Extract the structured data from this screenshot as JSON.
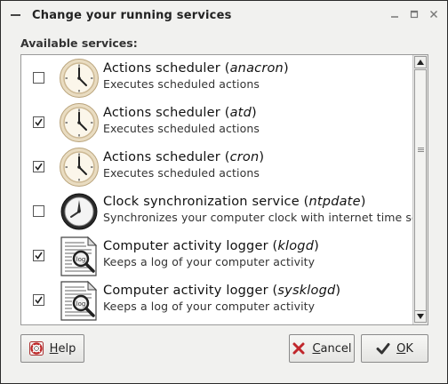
{
  "window": {
    "title": "Change your running services"
  },
  "main": {
    "section_label": "Available services:",
    "services": [
      {
        "name": "Actions scheduler (",
        "id": "anacron",
        "tail": ")",
        "description": "Executes scheduled actions",
        "checked": false,
        "icon": "clock-icon"
      },
      {
        "name": "Actions scheduler (",
        "id": "atd",
        "tail": ")",
        "description": "Executes scheduled actions",
        "checked": true,
        "icon": "clock-icon"
      },
      {
        "name": "Actions scheduler (",
        "id": "cron",
        "tail": ")",
        "description": "Executes scheduled actions",
        "checked": true,
        "icon": "clock-icon"
      },
      {
        "name": "Clock synchronization service (",
        "id": "ntpdate",
        "tail": ")",
        "description": "Synchronizes your computer clock with internet time servers",
        "checked": false,
        "icon": "sync-clock-icon"
      },
      {
        "name": "Computer activity logger (",
        "id": "klogd",
        "tail": ")",
        "description": "Keeps a log of your computer activity",
        "checked": true,
        "icon": "log-magnifier-icon"
      },
      {
        "name": "Computer activity logger (",
        "id": "sysklogd",
        "tail": ")",
        "description": "Keeps a log of your computer activity",
        "checked": true,
        "icon": "log-magnifier-icon"
      }
    ]
  },
  "buttons": {
    "help_first": "H",
    "help_rest": "elp",
    "cancel_first": "C",
    "cancel_rest": "ancel",
    "ok_first": "O",
    "ok_rest": "K"
  }
}
